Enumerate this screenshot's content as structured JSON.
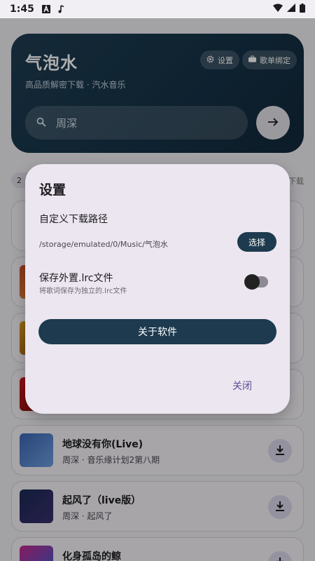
{
  "status_bar": {
    "time": "1:45"
  },
  "header": {
    "title": "气泡水",
    "subtitle": "高品质解密下载 · 汽水音乐",
    "settings_chip": "设置",
    "playlist_chip": "歌单绑定",
    "search_value": "周深"
  },
  "list": {
    "count_pill": "2",
    "download_label": "下载",
    "songs": [
      {
        "title": "地球没有你(Live)",
        "subtitle": "周深 · 音乐缘计划2第八期"
      },
      {
        "title": "起风了（live版）",
        "subtitle": "周深 · 起风了"
      },
      {
        "title": "化身孤岛的鲸",
        "subtitle": ""
      }
    ]
  },
  "dialog": {
    "title": "设置",
    "path_label": "自定义下载路径",
    "path_value": "/storage/emulated/0/Music/气泡水",
    "choose_button": "选择",
    "lrc_label": "保存外置.lrc文件",
    "lrc_desc": "将歌词保存为独立的.lrc文件",
    "lrc_enabled": false,
    "about_button": "关于软件",
    "close_button": "关闭"
  },
  "colors": {
    "primary_dark": "#1d3a4f",
    "dialog_bg": "#ece6f0",
    "accent_text": "#5b4f94"
  }
}
